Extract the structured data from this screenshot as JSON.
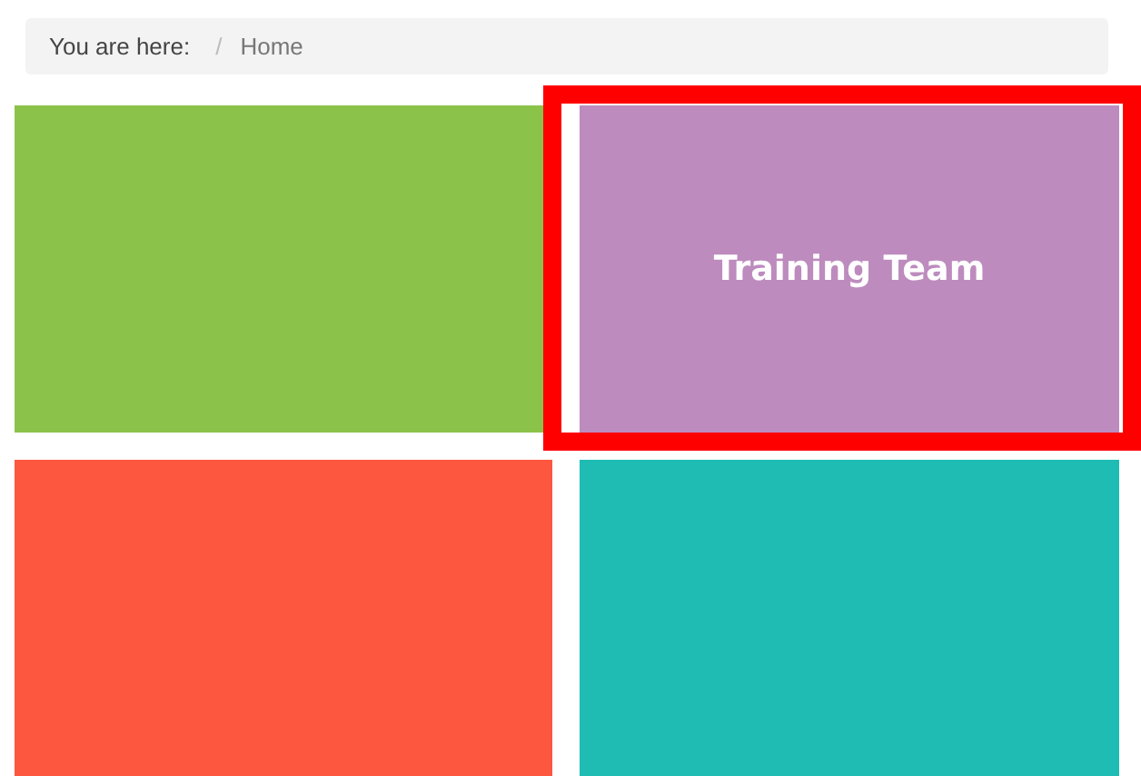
{
  "breadcrumb": {
    "prefix": "You are here:",
    "separator": "/",
    "items": [
      "Home"
    ]
  },
  "tiles": [
    {
      "color": "#8bc34a",
      "highlighted": false
    },
    {
      "label": "Training Team",
      "color": "#bd8bbe",
      "highlighted": true
    },
    {
      "color": "#fd573f",
      "highlighted": false
    },
    {
      "color": "#1fbcb4",
      "highlighted": false
    }
  ]
}
